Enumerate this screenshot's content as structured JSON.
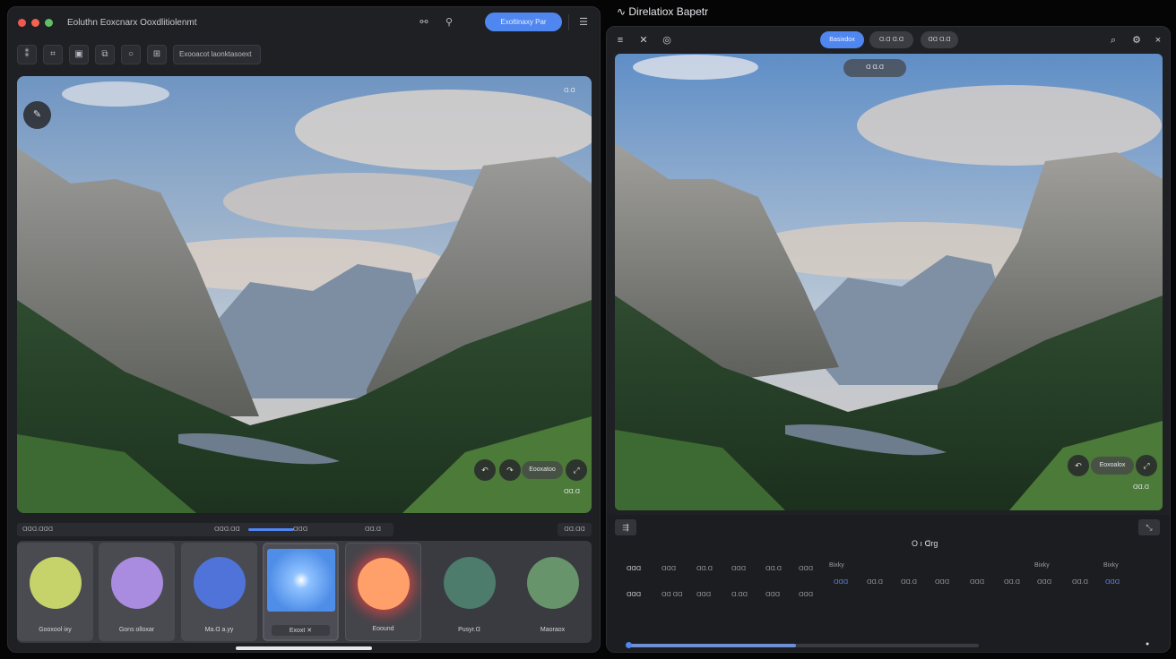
{
  "left_window": {
    "title": "Eoluthn Eoxcnarx Ooxdlitiolenmt",
    "primary_button": "Exoltinaxy Par",
    "toolbar_chip": "Exooacot laonktasoext",
    "photo_corner_chip": "ᗡ.ᗡ",
    "photo_pill_label": "Eooxatoo",
    "photo_bottom_label": "ᗡᗡ.ᗡ",
    "scrub": {
      "left": "ᗡᗡᗡ.ᗡᗡᗡ",
      "mid1": "ᗡᗡᗡ.ᗡᗡ",
      "mid2": "ᗡᗡᗡ",
      "right": "ᗡᗡ.ᗡ",
      "progress": 0.22
    },
    "chip_right": "ᗡᗡ.ᗡᗡ",
    "swatches": [
      {
        "label": "Gooxool ixy",
        "color": "#c6d36a"
      },
      {
        "label": "Gons olloxar",
        "color": "#a98ce0"
      },
      {
        "label": "Ma.ᗡ a.yy",
        "color": "#4f73d8"
      },
      {
        "label": "Exoxt  ✕",
        "color": "#5aa0f2"
      },
      {
        "label": "Eoound",
        "color": "#ffa06a"
      },
      {
        "label": "Pusyr.ᗡ",
        "color": "#4d7b6c"
      },
      {
        "label": "Maoraox",
        "color": "#67946a"
      }
    ]
  },
  "right_window": {
    "outer_title": "Direlatiox Bapetr",
    "segments": [
      "Basixdox",
      "ᗡ.ᗡ ᗡ.ᗡ",
      "ᗡᗡ ᗡ.ᗡ"
    ],
    "photo_top_chip": "ᗡ ᗡ.ᗡ",
    "photo_pill_label": "Eoxoalox",
    "photo_bottom_label": "ᗡᗡ.ᗡ",
    "panel_label": "O ı ᗡrg",
    "col_heads": [
      "Bixky",
      "Bixky",
      "Bixky"
    ],
    "row1": [
      "ᗡᗡᗡ",
      "ᗡᗡᗡ",
      "ᗡᗡ.ᗡ",
      "ᗡᗡᗡ",
      "ᗡᗡ.ᗡ",
      "ᗡᗡᗡ"
    ],
    "row1b": [
      "ᗡᗡᗡ",
      "ᗡᗡ.ᗡ",
      "ᗡᗡ.ᗡ",
      "ᗡᗡᗡ",
      "ᗡᗡᗡ",
      "ᗡᗡ.ᗡ",
      "ᗡᗡᗡ",
      "ᗡᗡ.ᗡ",
      "ᗡᗡᗡ"
    ],
    "row2": [
      "ᗡᗡᗡ",
      "ᗡᗡ ᗡᗡ",
      "ᗡᗡᗡ",
      "ᗡ.ᗡᗡ",
      "ᗡᗡᗡ",
      "ᗡᗡᗡ"
    ],
    "slider_progress": 0.48
  },
  "colors": {
    "accent": "#4f86f0",
    "window_bg": "#1f2024",
    "close": "#ee5a52",
    "minimize": "#f26350",
    "zoom": "#5fbf62"
  },
  "icons": [
    "close-dot",
    "minimize-dot",
    "zoom-dot",
    "link-icon",
    "person-icon",
    "menu-icon",
    "close-icon",
    "camera-icon",
    "search-icon",
    "settings-icon"
  ]
}
